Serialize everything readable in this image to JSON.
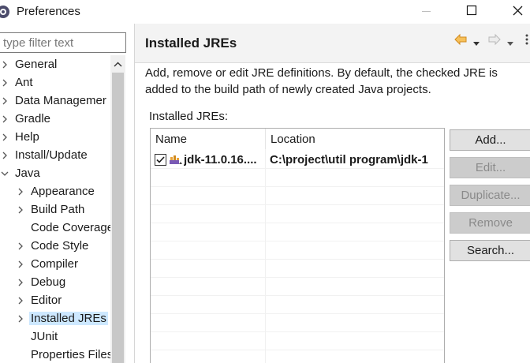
{
  "window": {
    "title": "Preferences",
    "icon": "eclipse-gear-icon",
    "controls": {
      "minimize": "minimize-icon",
      "maximize": "maximize-icon",
      "close": "close-icon"
    }
  },
  "sidebar": {
    "filter_placeholder": "type filter text",
    "items": [
      {
        "label": "General",
        "level": 0,
        "state": "collapsed"
      },
      {
        "label": "Ant",
        "level": 0,
        "state": "collapsed"
      },
      {
        "label": "Data Managemer",
        "level": 0,
        "state": "collapsed"
      },
      {
        "label": "Gradle",
        "level": 0,
        "state": "collapsed"
      },
      {
        "label": "Help",
        "level": 0,
        "state": "collapsed"
      },
      {
        "label": "Install/Update",
        "level": 0,
        "state": "collapsed"
      },
      {
        "label": "Java",
        "level": 0,
        "state": "expanded"
      },
      {
        "label": "Appearance",
        "level": 1,
        "state": "collapsed"
      },
      {
        "label": "Build Path",
        "level": 1,
        "state": "collapsed"
      },
      {
        "label": "Code Coverage",
        "level": 1,
        "state": "leaf"
      },
      {
        "label": "Code Style",
        "level": 1,
        "state": "collapsed"
      },
      {
        "label": "Compiler",
        "level": 1,
        "state": "collapsed"
      },
      {
        "label": "Debug",
        "level": 1,
        "state": "collapsed"
      },
      {
        "label": "Editor",
        "level": 1,
        "state": "collapsed"
      },
      {
        "label": "Installed JREs",
        "level": 1,
        "state": "collapsed",
        "selected": true
      },
      {
        "label": "JUnit",
        "level": 1,
        "state": "leaf"
      },
      {
        "label": "Properties Files",
        "level": 1,
        "state": "leaf"
      }
    ]
  },
  "page": {
    "title": "Installed JREs",
    "description": "Add, remove or edit JRE definitions. By default, the checked JRE is added to the build path of newly created Java projects.",
    "table_label": "Installed JREs:",
    "columns": [
      "Name",
      "Location"
    ],
    "rows": [
      {
        "checked": true,
        "name": "jdk-11.0.16....",
        "location": "C:\\project\\util program\\jdk-1"
      }
    ],
    "buttons": {
      "add": "Add...",
      "edit": "Edit...",
      "duplicate": "Duplicate...",
      "remove": "Remove",
      "search": "Search..."
    }
  },
  "colors": {
    "selection": "#cde8ff",
    "header_bg": "#f3f3f3",
    "button_bg": "#e1e1e1",
    "nav_arrow": "#e8a23a"
  }
}
